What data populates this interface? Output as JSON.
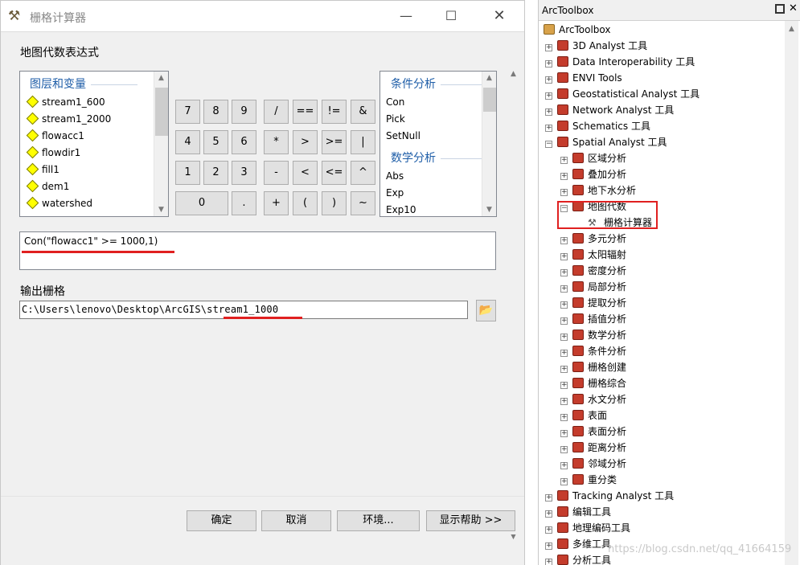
{
  "dialog": {
    "title": "栅格计算器",
    "title_icon": "hammer-icon",
    "expression_section_label": "地图代数表达式",
    "layers_header": "图层和变量",
    "layers": [
      "stream1_600",
      "stream1_2000",
      "flowacc1",
      "flowdir1",
      "fill1",
      "dem1",
      "watershed"
    ],
    "functions": {
      "group1_header": "条件分析",
      "group1_items": [
        "Con",
        "Pick",
        "SetNull"
      ],
      "group2_header": "数学分析",
      "group2_items": [
        "Abs",
        "Exp",
        "Exp10"
      ]
    },
    "keypad": {
      "row1": [
        "7",
        "8",
        "9",
        "/",
        "==",
        "!=",
        "&"
      ],
      "row2": [
        "4",
        "5",
        "6",
        "*",
        ">",
        ">=",
        "|"
      ],
      "row3": [
        "1",
        "2",
        "3",
        "-",
        "<",
        "<=",
        "^"
      ],
      "row4": [
        "0",
        ".",
        "+",
        "(",
        ")",
        "~"
      ]
    },
    "expression": "Con(\"flowacc1\" >= 1000,1)",
    "output_label": "输出栅格",
    "output_value": "C:\\Users\\lenovo\\Desktop\\ArcGIS\\stream1_1000",
    "buttons": {
      "ok": "确定",
      "cancel": "取消",
      "env": "环境...",
      "help": "显示帮助 >>"
    }
  },
  "toolbox": {
    "title": "ArcToolbox",
    "root": "ArcToolbox",
    "items_top": [
      "3D Analyst 工具",
      "Data Interoperability 工具",
      "ENVI Tools",
      "Geostatistical Analyst 工具",
      "Network Analyst 工具",
      "Schematics 工具",
      "Spatial Analyst 工具"
    ],
    "spatial_children_before": [
      "区域分析",
      "叠加分析",
      "地下水分析"
    ],
    "map_algebra": "地图代数",
    "raster_calculator": "栅格计算器",
    "spatial_children_after": [
      "多元分析",
      "太阳辐射",
      "密度分析",
      "局部分析",
      "提取分析",
      "插值分析",
      "数学分析",
      "条件分析",
      "栅格创建",
      "栅格综合",
      "水文分析",
      "表面",
      "表面分析",
      "距离分析",
      "邻域分析",
      "重分类"
    ],
    "items_bottom": [
      "Tracking Analyst 工具",
      "编辑工具",
      "地理编码工具",
      "多维工具",
      "分析工具"
    ]
  },
  "watermark": "https://blog.csdn.net/qq_41664159"
}
